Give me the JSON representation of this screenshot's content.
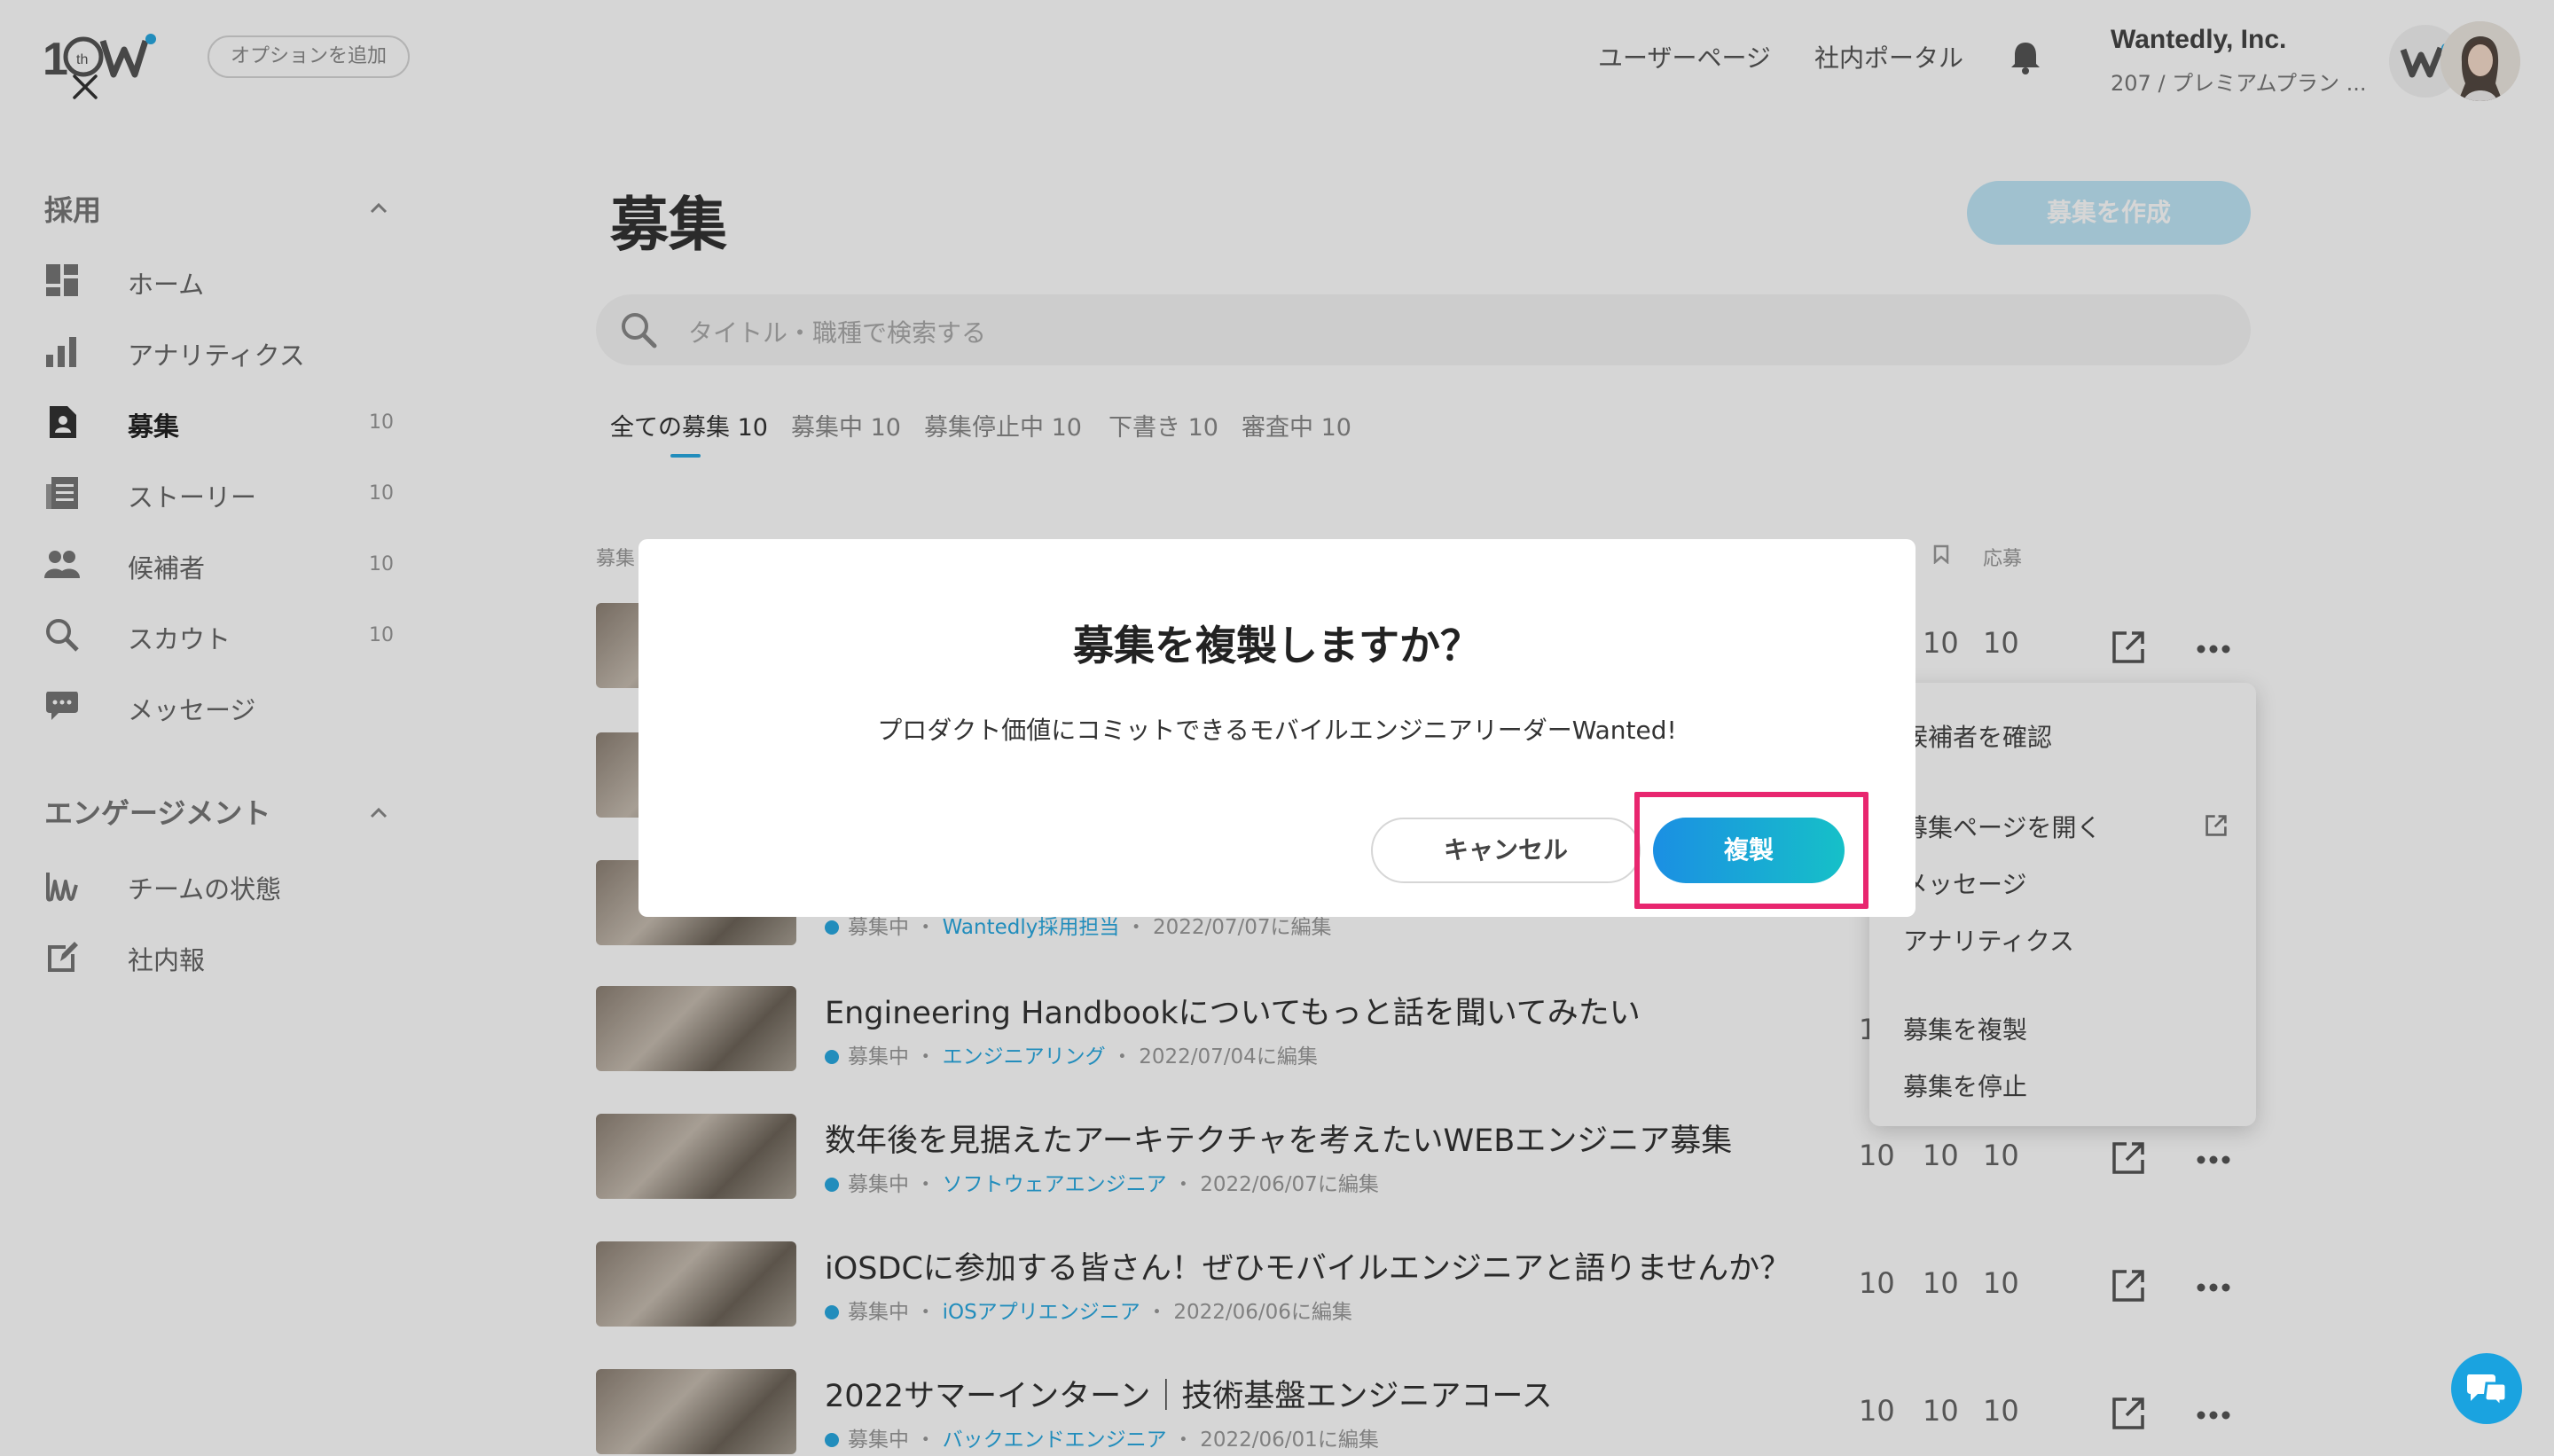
{
  "header": {
    "option_label": "オプションを追加",
    "user_page": "ユーザーページ",
    "portal": "社内ポータル",
    "company": "Wantedly, Inc.",
    "plan": "207 / プレミアムプラン ..."
  },
  "sidebar": {
    "recruit_section": "採用",
    "engagement_section": "エンゲージメント",
    "items": [
      {
        "label": "ホーム",
        "count": ""
      },
      {
        "label": "アナリティクス",
        "count": ""
      },
      {
        "label": "募集",
        "count": "10"
      },
      {
        "label": "ストーリー",
        "count": "10"
      },
      {
        "label": "候補者",
        "count": "10"
      },
      {
        "label": "スカウト",
        "count": "10"
      },
      {
        "label": "メッセージ",
        "count": ""
      }
    ],
    "engagement_items": [
      {
        "label": "チームの状態"
      },
      {
        "label": "社内報"
      }
    ]
  },
  "main": {
    "title": "募集",
    "create_button": "募集を作成",
    "search_placeholder": "タイトル・職種で検索する",
    "tabs": [
      "全ての募集 10",
      "募集中 10",
      "募集停止中 10",
      "下書き 10",
      "審査中 10"
    ],
    "column_left": "募集",
    "column_right": "応募",
    "jobs": [
      {
        "title": "",
        "status": "",
        "tag": "",
        "date": "",
        "stats": [
          "10",
          "10"
        ]
      },
      {
        "title": "",
        "status": "",
        "tag": "",
        "date": "",
        "stats": []
      },
      {
        "title": "",
        "status": "募集中",
        "tag": "Wantedly採用担当",
        "date": "2022/07/07に編集",
        "stats": []
      },
      {
        "title": "Engineering Handbookについてもっと話を聞いてみたい",
        "status": "募集中",
        "tag": "エンジニアリング",
        "date": "2022/07/04に編集",
        "stats": [
          "10"
        ]
      },
      {
        "title": "数年後を見据えたアーキテクチャを考えたいWEBエンジニア募集",
        "status": "募集中",
        "tag": "ソフトウェアエンジニア",
        "date": "2022/06/07に編集",
        "stats": [
          "10",
          "10",
          "10"
        ]
      },
      {
        "title": "iOSDCに参加する皆さん！ぜひモバイルエンジニアと語りませんか？",
        "status": "募集中",
        "tag": "iOSアプリエンジニア",
        "date": "2022/06/06に編集",
        "stats": [
          "10",
          "10",
          "10"
        ]
      },
      {
        "title": "2022サマーインターン｜技術基盤エンジニアコース",
        "status": "募集中",
        "tag": "バックエンドエンジニア",
        "date": "2022/06/01に編集",
        "stats": [
          "10",
          "10",
          "10"
        ]
      }
    ]
  },
  "context_menu": {
    "items": [
      "候補者を確認",
      "募集ページを開く",
      "メッセージ",
      "アナリティクス",
      "募集を複製",
      "募集を停止"
    ]
  },
  "dialog": {
    "title": "募集を複製しますか？",
    "body": "プロダクト価値にコミットできるモバイルエンジニアリーダーWanted!",
    "cancel": "キャンセル",
    "confirm": "複製"
  },
  "colors": {
    "accent": "#29a8e0",
    "highlight": "#e8266f",
    "confirm_start": "#1b8fe3",
    "confirm_end": "#16c0c8"
  }
}
